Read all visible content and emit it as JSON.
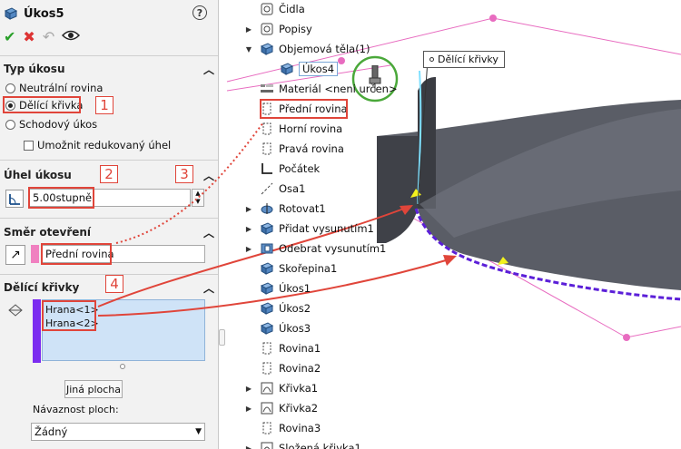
{
  "header": {
    "title": "Úkos5",
    "help": "?"
  },
  "sections": {
    "typ": {
      "title": "Typ úkosu",
      "options": [
        "Neutrální rovina",
        "Dělící křivka",
        "Schodový úkos"
      ],
      "selected": "Dělící křivka",
      "checkbox": "Umožnit redukovaný úhel"
    },
    "uhel": {
      "title": "Úhel úkosu",
      "value": "5.00stupně"
    },
    "smer": {
      "title": "Směr otevření",
      "value": "Přední rovina"
    },
    "delici": {
      "title": "Dělící křivky",
      "items": [
        "Hrana<1>",
        "Hrana<2>"
      ],
      "button": "Jiná plocha"
    },
    "navaznost": {
      "label": "Návaznost ploch:",
      "value": "Žádný"
    }
  },
  "annotations": [
    "1",
    "2",
    "3",
    "4"
  ],
  "tree": [
    {
      "label": "Čidla",
      "icon": "sensor-icon",
      "expand": false
    },
    {
      "label": "Popisy",
      "icon": "annotations-icon",
      "expand": true
    },
    {
      "label": "Objemová těla(1)",
      "icon": "solid-bodies-icon",
      "expand": true,
      "open": true
    },
    {
      "label": "Úkos4",
      "icon": "body-icon"
    },
    {
      "label": "Materiál <neni určen>",
      "icon": "material-icon"
    },
    {
      "label": "Přední rovina",
      "icon": "plane-icon"
    },
    {
      "label": "Horní rovina",
      "icon": "plane-icon"
    },
    {
      "label": "Pravá rovina",
      "icon": "plane-icon"
    },
    {
      "label": "Počátek",
      "icon": "origin-icon"
    },
    {
      "label": "Osa1",
      "icon": "axis-icon"
    },
    {
      "label": "Rotovat1",
      "icon": "revolve-icon",
      "expand": true
    },
    {
      "label": "Přidat vysunutím1",
      "icon": "extrude-icon",
      "expand": true
    },
    {
      "label": "Odebrat vysunutím1",
      "icon": "cut-extrude-icon",
      "expand": true
    },
    {
      "label": "Skořepina1",
      "icon": "shell-icon"
    },
    {
      "label": "Úkos1",
      "icon": "draft-icon"
    },
    {
      "label": "Úkos2",
      "icon": "draft-icon"
    },
    {
      "label": "Úkos3",
      "icon": "draft-icon"
    },
    {
      "label": "Rovina1",
      "icon": "plane-icon"
    },
    {
      "label": "Rovina2",
      "icon": "plane-icon"
    },
    {
      "label": "Křivka1",
      "icon": "curve-icon",
      "expand": true
    },
    {
      "label": "Křivka2",
      "icon": "curve-icon",
      "expand": true
    },
    {
      "label": "Rovina3",
      "icon": "plane-icon"
    },
    {
      "label": "Složená křivka1",
      "icon": "composite-curve-icon",
      "expand": true
    }
  ],
  "viewport": {
    "callout": "Dělící křivky"
  },
  "colors": {
    "annotation": "#e0453a",
    "plane": "#e86cc0",
    "selection": "#7b2cf0",
    "listbox": "#cfe3f7",
    "ok": "#2aa02a",
    "cancel": "#d33"
  }
}
